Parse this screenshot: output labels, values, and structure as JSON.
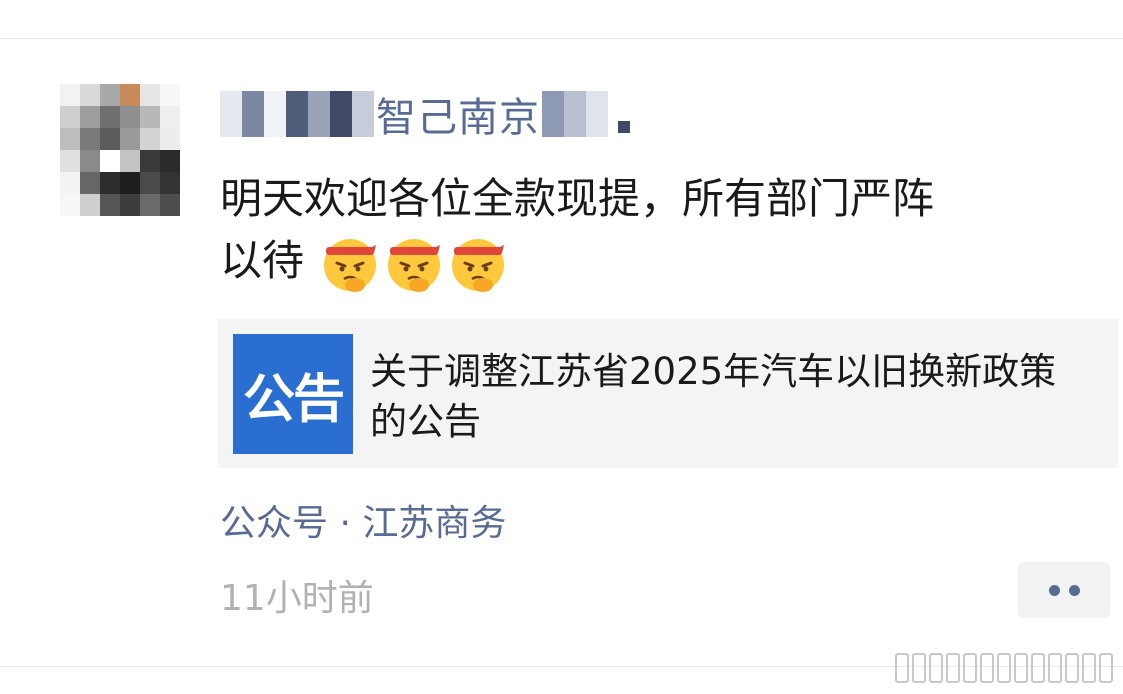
{
  "post": {
    "username_visible": "智己南京",
    "text_line1": "明天欢迎各位全款现提，所有部门严阵",
    "text_line2": "以待",
    "emoji": [
      "fighting-face-emoji",
      "fighting-face-emoji",
      "fighting-face-emoji"
    ],
    "link_card": {
      "thumb_label": "公告",
      "title": "关于调整江苏省2025年汽车以旧换新政策的公告"
    },
    "source": "公众号 · 江苏商务",
    "timestamp": "11小时前"
  },
  "colors": {
    "link_blue": "#576b95",
    "thumb_blue": "#2b6ed1",
    "card_bg": "#f4f4f4",
    "timestamp_gray": "#b2b2b2"
  }
}
